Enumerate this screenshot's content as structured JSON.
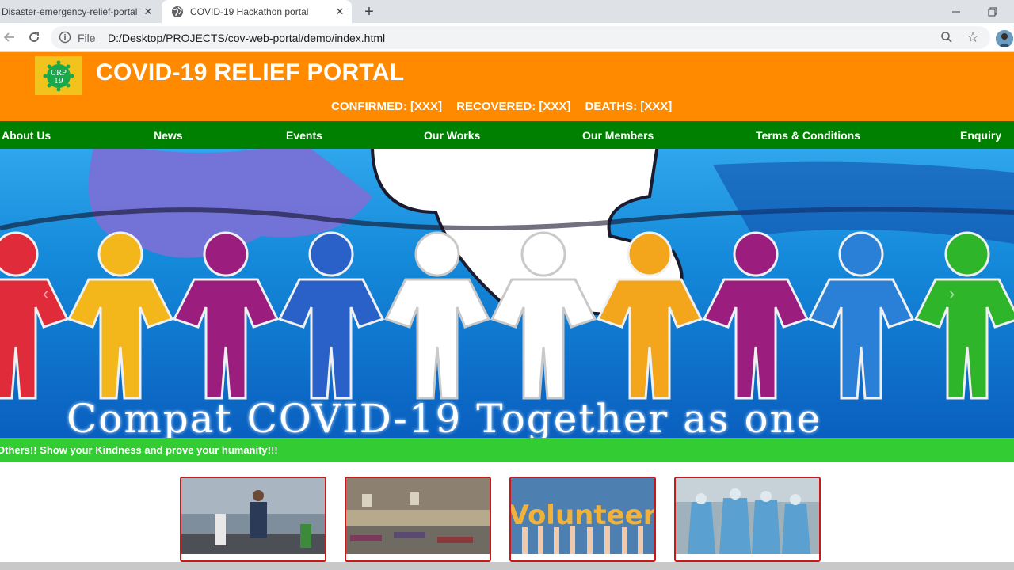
{
  "browser": {
    "tabs": [
      {
        "title": "Disaster-emergency-relief-portal",
        "active": false
      },
      {
        "title": "COVID-19 Hackathon portal",
        "active": true
      }
    ],
    "address": {
      "scheme_label": "File",
      "url": "D:/Desktop/PROJECTS/cov-web-portal/demo/index.html"
    }
  },
  "site": {
    "logo_text_top": "CRP",
    "logo_text_bottom": "19",
    "title": "COVID-19 RELIEF PORTAL",
    "stats": {
      "confirmed": "CONFIRMED: [XXX]",
      "recovered": "RECOVERED: [XXX]",
      "deaths": "DEATHS: [XXX]"
    },
    "nav": [
      {
        "label": "About Us"
      },
      {
        "label": "News"
      },
      {
        "label": "Events"
      },
      {
        "label": "Our Works"
      },
      {
        "label": "Our Members"
      },
      {
        "label": "Terms & Conditions"
      },
      {
        "label": "Enquiry"
      }
    ],
    "hero_caption": "Compat COVID-19 Together as one",
    "marquee": "Others!! Show your Kindness and prove your humanity!!!",
    "cards": [
      {
        "image": "migrant-workers-walking"
      },
      {
        "image": "shelter-hall-beds"
      },
      {
        "image": "volunteer-hands",
        "image_text": "Volunteer"
      },
      {
        "image": "medical-staff-ppe"
      }
    ]
  },
  "colors": {
    "header_orange": "#ff8a00",
    "nav_green": "#008000",
    "marquee_green": "#33cc33",
    "card_border": "#c61a1a"
  }
}
